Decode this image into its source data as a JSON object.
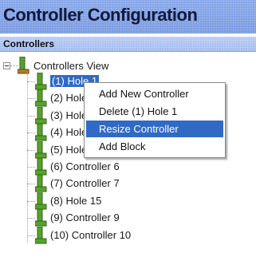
{
  "header": {
    "title": "Controller Configuration"
  },
  "section": {
    "label": "Controllers"
  },
  "tree": {
    "root_label": "Controllers View",
    "items": [
      {
        "label": "(1) Hole 1"
      },
      {
        "label": "(2) Hole 2"
      },
      {
        "label": "(3) Hole 3"
      },
      {
        "label": "(4) Hole 4"
      },
      {
        "label": "(5) Hole 5"
      },
      {
        "label": "(6) Controller 6"
      },
      {
        "label": "(7) Controller 7"
      },
      {
        "label": "(8) Hole 15"
      },
      {
        "label": "(9) Controller 9"
      },
      {
        "label": "(10) Controller 10"
      }
    ],
    "selected_index": 0
  },
  "context_menu": {
    "items": [
      {
        "label": "Add New Controller"
      },
      {
        "label": "Delete (1)  Hole 1"
      },
      {
        "label": "Resize Controller"
      },
      {
        "label": "Add Block"
      }
    ],
    "highlighted_index": 2
  },
  "icons": {
    "root": "controllers-view-icon",
    "node": "controller-icon"
  },
  "colors": {
    "title_bar": "#7d9fe4",
    "section_bar": "#a8c0f0",
    "selection": "#316ac5",
    "icon_green": "#5aa02c"
  }
}
